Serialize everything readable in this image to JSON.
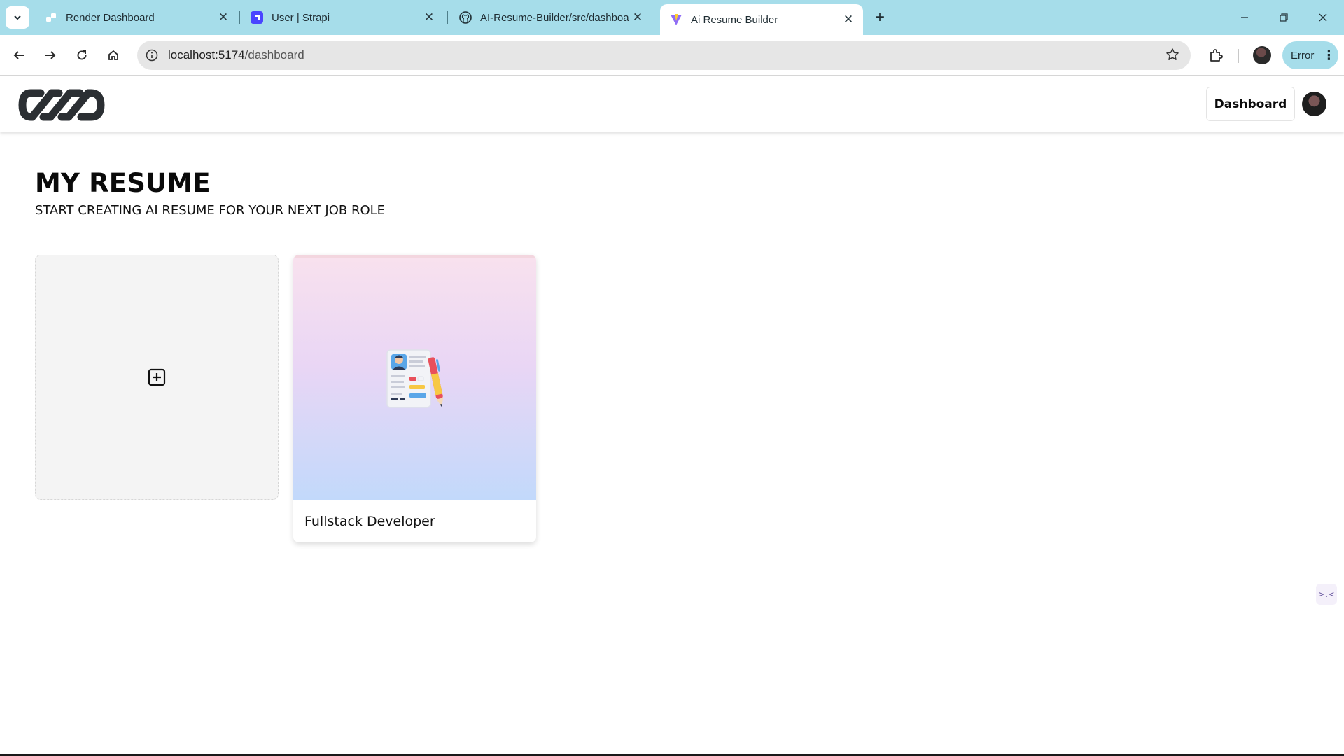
{
  "browser": {
    "tabs": [
      {
        "title": "Render Dashboard",
        "icon": "render-icon"
      },
      {
        "title": "User | Strapi",
        "icon": "strapi-icon"
      },
      {
        "title": "AI-Resume-Builder/src/dashboa",
        "icon": "github-icon"
      },
      {
        "title": "Ai Resume Builder",
        "icon": "vite-icon",
        "active": true
      }
    ],
    "url_host": "localhost:5174",
    "url_path": "/dashboard",
    "error_label": "Error"
  },
  "header": {
    "dashboard_label": "Dashboard"
  },
  "main": {
    "title": "MY RESUME",
    "subtitle": "START CREATING AI RESUME FOR YOUR NEXT JOB ROLE",
    "resumes": [
      {
        "title": "Fullstack Developer"
      }
    ]
  },
  "colors": {
    "tabbar_bg": "#a6ddea",
    "card_gradient_top": "#f8e1ee",
    "card_gradient_bottom": "#c2d9fb"
  }
}
